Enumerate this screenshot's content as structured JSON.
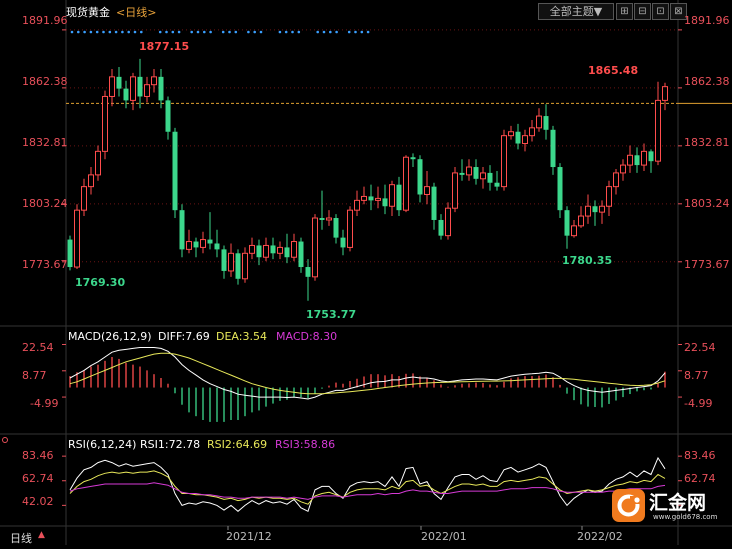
{
  "header": {
    "instrument": "现货黄金",
    "period": "<日线>",
    "theme_button": "全部主题▼",
    "toolbar_icons": [
      "grid-icon",
      "line-icon",
      "panel-icon",
      "close-icon"
    ]
  },
  "footer": {
    "period_label": "日线",
    "period_arrows": "▲",
    "x_ticks": [
      "2021/12",
      "2022/01",
      "2022/02"
    ]
  },
  "price_panel": {
    "y_ticks": [
      "1891.96",
      "1862.38",
      "1832.81",
      "1803.24",
      "1773.67"
    ],
    "annotations": {
      "high": "1877.15",
      "low1": "1769.30",
      "low2": "1753.77",
      "low3": "1780.35",
      "last_high": "1865.48"
    }
  },
  "macd_panel": {
    "label": "MACD(26,12,9)",
    "diff_label": "DIFF:7.69",
    "dea_label": "DEA:3.54",
    "macd_label": "MACD:8.30",
    "y_ticks": [
      "22.54",
      "8.77",
      "-4.99"
    ]
  },
  "rsi_panel": {
    "label": "RSI(6,12,24)",
    "rsi1_label": "RSI1:72.78",
    "rsi2_label": "RSI2:64.69",
    "rsi3_label": "RSI3:58.86",
    "y_ticks": [
      "83.46",
      "62.74",
      "42.02"
    ]
  },
  "watermark": {
    "text": "汇金网",
    "url": "www.gold678.com"
  },
  "colors": {
    "up": "#ff4d4d",
    "down": "#3cd78c",
    "diff": "#ffffff",
    "dea": "#e8e85a",
    "rsi3": "#d63ad6",
    "axis_text": "#e8505a",
    "grid": "#6b1414"
  },
  "chart_data": [
    {
      "type": "candlestick",
      "title": "现货黄金 日线",
      "ylim": [
        1745,
        1897
      ],
      "y_ticks": [
        1891.96,
        1862.38,
        1832.81,
        1803.24,
        1773.67
      ],
      "x_ticks": [
        "2021/12",
        "2022/01",
        "2022/02"
      ],
      "reference_line": 1854.5,
      "candles": [
        [
          1785,
          1771,
          1787,
          1769.3
        ],
        [
          1771,
          1800,
          1803,
          1770
        ],
        [
          1800,
          1812,
          1816,
          1797
        ],
        [
          1812,
          1818,
          1822,
          1808
        ],
        [
          1818,
          1830,
          1833,
          1815
        ],
        [
          1830,
          1858,
          1861,
          1826
        ],
        [
          1858,
          1868,
          1872,
          1853
        ],
        [
          1868,
          1862,
          1873,
          1858
        ],
        [
          1862,
          1856,
          1866,
          1852
        ],
        [
          1856,
          1868,
          1870,
          1851
        ],
        [
          1868,
          1858,
          1877.15,
          1852
        ],
        [
          1858,
          1864,
          1868,
          1855
        ],
        [
          1864,
          1868,
          1872,
          1860
        ],
        [
          1868,
          1856,
          1872,
          1852
        ],
        [
          1856,
          1840,
          1858,
          1836
        ],
        [
          1840,
          1800,
          1842,
          1796
        ],
        [
          1800,
          1780,
          1803,
          1776
        ],
        [
          1780,
          1784,
          1790,
          1778
        ],
        [
          1784,
          1781,
          1786,
          1776
        ],
        [
          1781,
          1785,
          1789,
          1778
        ],
        [
          1785,
          1783,
          1799,
          1780
        ],
        [
          1783,
          1780,
          1790,
          1776
        ],
        [
          1780,
          1769,
          1782,
          1765
        ],
        [
          1769,
          1778,
          1783,
          1766
        ],
        [
          1778,
          1765,
          1780,
          1762
        ],
        [
          1765,
          1778,
          1781,
          1763
        ],
        [
          1778,
          1782,
          1786,
          1775
        ],
        [
          1782,
          1776,
          1785,
          1772
        ],
        [
          1776,
          1782,
          1786,
          1774
        ],
        [
          1782,
          1778,
          1786,
          1775
        ],
        [
          1778,
          1781,
          1784,
          1775
        ],
        [
          1781,
          1776,
          1788,
          1773
        ],
        [
          1776,
          1784,
          1788,
          1774
        ],
        [
          1784,
          1771,
          1786,
          1768
        ],
        [
          1771,
          1766,
          1775,
          1753.77
        ],
        [
          1766,
          1796,
          1798,
          1764
        ],
        [
          1796,
          1795,
          1810,
          1790
        ],
        [
          1795,
          1796,
          1800,
          1792
        ],
        [
          1796,
          1786,
          1798,
          1783
        ],
        [
          1786,
          1781,
          1790,
          1777
        ],
        [
          1781,
          1800,
          1802,
          1779
        ],
        [
          1800,
          1805,
          1810,
          1797
        ],
        [
          1805,
          1807,
          1812,
          1803
        ],
        [
          1807,
          1805,
          1813,
          1800
        ],
        [
          1805,
          1806,
          1812,
          1801
        ],
        [
          1806,
          1802,
          1813,
          1798
        ],
        [
          1802,
          1813,
          1815,
          1797
        ],
        [
          1813,
          1800,
          1817,
          1797
        ],
        [
          1800,
          1827,
          1828,
          1799
        ],
        [
          1827,
          1826,
          1829,
          1822
        ],
        [
          1826,
          1808,
          1828,
          1804
        ],
        [
          1808,
          1812,
          1820,
          1803
        ],
        [
          1812,
          1795,
          1814,
          1790
        ],
        [
          1795,
          1787,
          1798,
          1785
        ],
        [
          1787,
          1801,
          1804,
          1785
        ],
        [
          1801,
          1819,
          1822,
          1799
        ],
        [
          1819,
          1818,
          1826,
          1815
        ],
        [
          1818,
          1822,
          1826,
          1815
        ],
        [
          1822,
          1816,
          1826,
          1813
        ],
        [
          1816,
          1819,
          1822,
          1811
        ],
        [
          1819,
          1814,
          1823,
          1810
        ],
        [
          1814,
          1812,
          1820,
          1810
        ],
        [
          1812,
          1838,
          1841,
          1810
        ],
        [
          1838,
          1840,
          1843,
          1836
        ],
        [
          1840,
          1834,
          1844,
          1831
        ],
        [
          1834,
          1838,
          1841,
          1830
        ],
        [
          1838,
          1842,
          1846,
          1835
        ],
        [
          1842,
          1848,
          1852,
          1840
        ],
        [
          1848,
          1841,
          1854,
          1836
        ],
        [
          1841,
          1822,
          1843,
          1818
        ],
        [
          1822,
          1800,
          1824,
          1796
        ],
        [
          1800,
          1787,
          1802,
          1780.35
        ],
        [
          1787,
          1792,
          1795,
          1786
        ],
        [
          1792,
          1797,
          1802,
          1791
        ],
        [
          1797,
          1802,
          1808,
          1793
        ],
        [
          1802,
          1799,
          1805,
          1792
        ],
        [
          1799,
          1802,
          1805,
          1793
        ],
        [
          1802,
          1812,
          1815,
          1797
        ],
        [
          1812,
          1819,
          1821,
          1808
        ],
        [
          1819,
          1823,
          1826,
          1815
        ],
        [
          1823,
          1828,
          1833,
          1819
        ],
        [
          1828,
          1823,
          1832,
          1819
        ],
        [
          1823,
          1830,
          1834,
          1820
        ],
        [
          1830,
          1825,
          1831,
          1819
        ],
        [
          1825,
          1856,
          1865.48,
          1823
        ],
        [
          1856,
          1863,
          1865,
          1851
        ]
      ]
    },
    {
      "type": "macd",
      "title": "MACD(26,12,9)",
      "ylim": [
        -17,
        27
      ],
      "y_ticks": [
        22.54,
        8.77,
        -4.99
      ],
      "series": [
        {
          "name": "DIFF",
          "values": [
            5,
            7,
            9,
            11.5,
            13.5,
            16,
            18.5,
            19.5,
            20,
            20.5,
            21,
            21,
            21,
            20.5,
            19,
            16,
            12,
            9,
            6.5,
            4,
            2,
            0.5,
            -1,
            -2,
            -3.5,
            -4,
            -4.5,
            -5,
            -5,
            -5,
            -5,
            -5.2,
            -5,
            -5.5,
            -6,
            -5,
            -3.5,
            -2.5,
            -1.5,
            -1.5,
            -0.5,
            0.5,
            1.5,
            2.5,
            3,
            3.2,
            4,
            4,
            5,
            5.5,
            5,
            5,
            4.5,
            3.5,
            3,
            3.5,
            4,
            4.2,
            4.5,
            4.5,
            4.2,
            4,
            5,
            6,
            6.5,
            7,
            7.2,
            7.5,
            8,
            7.5,
            5.5,
            3,
            1,
            -0.5,
            -1.5,
            -2,
            -2.5,
            -2,
            -1.5,
            -1,
            -0.5,
            0,
            0.5,
            1,
            3.5,
            7.69
          ]
        },
        {
          "name": "DEA",
          "values": [
            2,
            3,
            4.5,
            6,
            7.5,
            9,
            10.5,
            12,
            13.5,
            14.5,
            15.5,
            16.5,
            17.5,
            18,
            18,
            17.5,
            16.5,
            15.5,
            14,
            12.5,
            11,
            9.5,
            8,
            6.5,
            5,
            3.5,
            2,
            1,
            0,
            -0.8,
            -1.5,
            -2,
            -2.5,
            -3,
            -3.2,
            -3.3,
            -3.2,
            -3,
            -2.8,
            -2.5,
            -2.2,
            -1.8,
            -1.4,
            -1,
            -0.5,
            0,
            0.5,
            1,
            1.4,
            1.8,
            2.1,
            2.4,
            2.6,
            2.7,
            2.8,
            2.9,
            3,
            3.1,
            3.2,
            3.3,
            3.4,
            3.4,
            3.5,
            3.6,
            3.8,
            4,
            4.2,
            4.4,
            4.6,
            4.8,
            4.8,
            4.6,
            4.3,
            3.9,
            3.5,
            3.1,
            2.7,
            2.3,
            1.9,
            1.5,
            1.2,
            1,
            1.2,
            1.5,
            2.4,
            3.54
          ]
        }
      ]
    },
    {
      "type": "rsi",
      "title": "RSI(6,12,24)",
      "ylim": [
        28,
        92
      ],
      "y_ticks": [
        83.46,
        62.74,
        42.02
      ],
      "series": [
        {
          "name": "RSI1",
          "values": [
            55,
            65,
            72,
            74,
            78,
            80,
            78,
            75,
            77,
            75,
            76,
            77,
            78,
            74,
            68,
            52,
            42,
            44,
            43,
            45,
            44,
            42,
            38,
            42,
            37,
            42,
            46,
            43,
            46,
            44,
            45,
            43,
            47,
            40,
            37,
            55,
            58,
            58,
            52,
            48,
            58,
            61,
            62,
            61,
            62,
            58,
            66,
            58,
            73,
            74,
            60,
            62,
            52,
            47,
            57,
            66,
            68,
            68,
            64,
            67,
            63,
            62,
            72,
            74,
            70,
            72,
            74,
            77,
            74,
            62,
            50,
            42,
            48,
            52,
            55,
            53,
            54,
            60,
            64,
            66,
            70,
            66,
            71,
            68,
            82,
            72.78
          ]
        },
        {
          "name": "RSI2",
          "values": [
            52,
            58,
            62,
            64,
            67,
            69,
            70,
            69,
            70,
            69,
            70,
            70,
            71,
            69,
            66,
            58,
            52,
            52,
            51,
            51,
            50,
            49,
            47,
            48,
            46,
            47,
            49,
            48,
            49,
            48,
            48,
            47,
            48,
            45,
            43,
            50,
            52,
            53,
            51,
            49,
            53,
            55,
            56,
            56,
            56,
            55,
            58,
            56,
            62,
            63,
            58,
            59,
            55,
            52,
            55,
            58,
            60,
            60,
            59,
            60,
            58,
            58,
            62,
            63,
            62,
            63,
            64,
            66,
            65,
            60,
            55,
            52,
            53,
            54,
            55,
            54,
            55,
            57,
            59,
            60,
            62,
            61,
            63,
            62,
            68,
            64.69
          ]
        },
        {
          "name": "RSI3",
          "values": [
            54,
            56,
            57,
            58,
            59,
            60,
            60,
            60,
            60,
            60,
            60,
            60,
            61,
            60,
            59,
            56,
            53,
            52,
            52,
            51,
            51,
            50,
            49,
            49,
            48,
            48,
            49,
            49,
            49,
            49,
            49,
            48,
            49,
            48,
            47,
            49,
            50,
            50,
            50,
            49,
            50,
            51,
            51,
            51,
            52,
            51,
            52,
            52,
            54,
            55,
            54,
            54,
            53,
            52,
            52,
            53,
            54,
            54,
            54,
            54,
            54,
            54,
            55,
            56,
            56,
            56,
            57,
            57,
            57,
            56,
            54,
            53,
            53,
            53,
            53,
            53,
            53,
            54,
            54,
            55,
            56,
            56,
            56,
            56,
            58,
            58.86
          ]
        }
      ]
    }
  ]
}
